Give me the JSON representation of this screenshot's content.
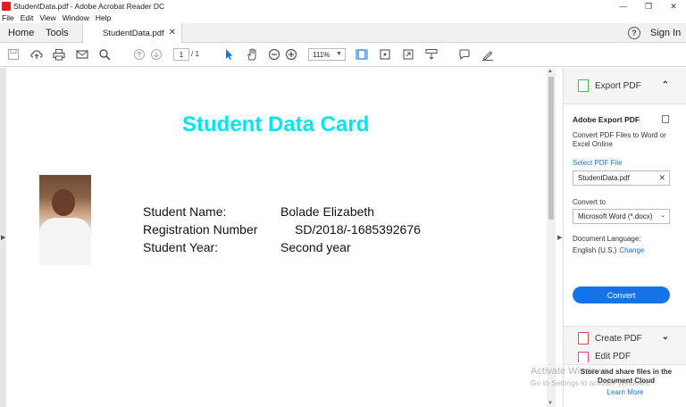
{
  "window": {
    "title": "StudentData.pdf - Adobe Acrobat Reader DC"
  },
  "menu": [
    "File",
    "Edit",
    "View",
    "Window",
    "Help"
  ],
  "tabs": {
    "home": "Home",
    "tools": "Tools",
    "document": "StudentData.pdf"
  },
  "header": {
    "help_icon": "?",
    "sign_in": "Sign In"
  },
  "toolbar": {
    "page_current": "1",
    "page_total": "/ 1",
    "zoom": "111%"
  },
  "document": {
    "title": "Student Data Card",
    "fields": [
      {
        "label": "Student Name:",
        "value": "Bolade Elizabeth"
      },
      {
        "label": "Registration Number",
        "value": "SD/2018/-1685392676"
      },
      {
        "label": "Student Year:",
        "value": "Second year"
      }
    ]
  },
  "panel": {
    "export_header": "Export PDF",
    "export_title": "Adobe Export PDF",
    "export_desc": "Convert PDF Files to Word or Excel Online",
    "select_file": "Select PDF File",
    "file_name": "StudentData.pdf",
    "convert_to_label": "Convert to",
    "convert_to_value": "Microsoft Word (*.docx)",
    "language_label": "Document Language:",
    "language_value": "English (U.S.)",
    "change": "Change",
    "convert_button": "Convert",
    "create_pdf": "Create PDF",
    "edit_pdf": "Edit PDF",
    "cloud_text": "Store and share files in the Document Cloud",
    "learn_more": "Learn More"
  },
  "watermark": {
    "line1": "Activate Windows",
    "line2": "Go to Settings to activate Windows."
  },
  "colors": {
    "title_cyan": "#00e5f0",
    "accent_blue": "#1473e6",
    "acrobat_red": "#d8231c"
  }
}
